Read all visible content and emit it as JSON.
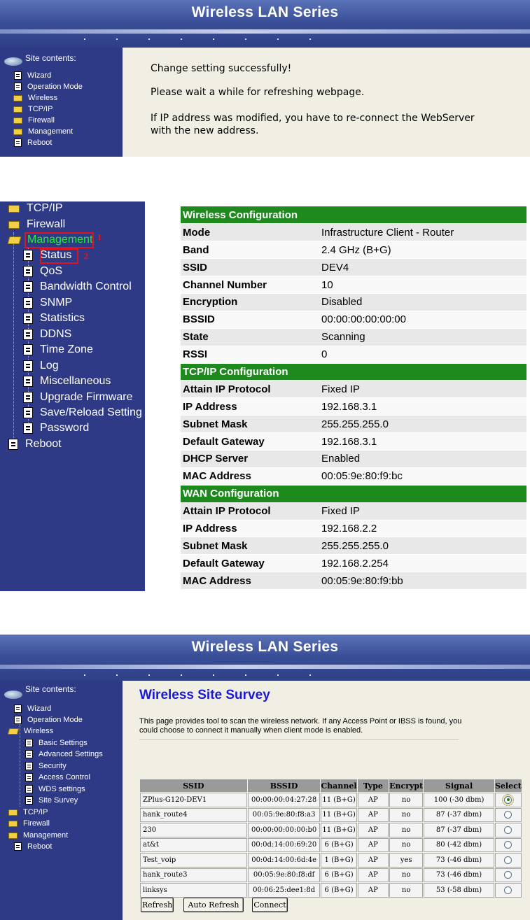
{
  "panel1": {
    "banner_title": "Wireless LAN Series",
    "sidebar_heading": "Site contents:",
    "nav": [
      {
        "label": "Wizard",
        "icon": "page-icon"
      },
      {
        "label": "Operation Mode",
        "icon": "page-icon"
      },
      {
        "label": "Wireless",
        "icon": "folder-icon"
      },
      {
        "label": "TCP/IP",
        "icon": "folder-icon"
      },
      {
        "label": "Firewall",
        "icon": "folder-icon"
      },
      {
        "label": "Management",
        "icon": "folder-icon"
      },
      {
        "label": "Reboot",
        "icon": "page-icon"
      }
    ],
    "messages": [
      "Change setting successfully!",
      "Please wait a while for refreshing webpage.",
      "If IP address was modified, you have to re-connect the WebServer",
      "with the new address."
    ]
  },
  "panel2": {
    "nav": {
      "tcpip": "TCP/IP",
      "firewall": "Firewall",
      "management": "Management",
      "items": [
        "Status",
        "QoS",
        "Bandwidth Control",
        "SNMP",
        "Statistics",
        "DDNS",
        "Time Zone",
        "Log",
        "Miscellaneous",
        "Upgrade Firmware",
        "Save/Reload Setting",
        "Password"
      ],
      "reboot": "Reboot"
    },
    "annotations": {
      "label1": "1",
      "label2": "2",
      "color": "#e0141e"
    },
    "sections": [
      {
        "title": "Wireless Configuration",
        "rows": [
          [
            "Mode",
            "Infrastructure Client - Router"
          ],
          [
            "Band",
            "2.4 GHz (B+G)"
          ],
          [
            "SSID",
            "DEV4"
          ],
          [
            "Channel Number",
            "10"
          ],
          [
            "Encryption",
            "Disabled"
          ],
          [
            "BSSID",
            "00:00:00:00:00:00"
          ],
          [
            "State",
            "Scanning"
          ],
          [
            "RSSI",
            "0"
          ]
        ]
      },
      {
        "title": "TCP/IP Configuration",
        "rows": [
          [
            "Attain IP Protocol",
            "Fixed IP"
          ],
          [
            "IP Address",
            "192.168.3.1"
          ],
          [
            "Subnet Mask",
            "255.255.255.0"
          ],
          [
            "Default Gateway",
            "192.168.3.1"
          ],
          [
            "DHCP Server",
            "Enabled"
          ],
          [
            "MAC Address",
            "00:05:9e:80:f9:bc"
          ]
        ]
      },
      {
        "title": "WAN Configuration",
        "rows": [
          [
            "Attain IP Protocol",
            "Fixed IP"
          ],
          [
            "IP Address",
            "192.168.2.2"
          ],
          [
            "Subnet Mask",
            "255.255.255.0"
          ],
          [
            "Default Gateway",
            "192.168.2.254"
          ],
          [
            "MAC Address",
            "00:05:9e:80:f9:bb"
          ]
        ]
      }
    ]
  },
  "panel3": {
    "banner_title": "Wireless LAN Series",
    "sidebar_heading": "Site contents:",
    "nav": {
      "wizard": "Wizard",
      "operation_mode": "Operation Mode",
      "wireless": "Wireless",
      "wireless_items": [
        "Basic Settings",
        "Advanced Settings",
        "Security",
        "Access Control",
        "WDS settings",
        "Site Survey"
      ],
      "tcpip": "TCP/IP",
      "firewall": "Firewall",
      "management": "Management",
      "reboot": "Reboot"
    },
    "title": "Wireless Site Survey",
    "description": "This page provides tool to scan the wireless network. If any Access Point or IBSS is found, you could choose to connect it manually when client mode is enabled.",
    "columns": [
      "SSID",
      "BSSID",
      "Channel",
      "Type",
      "Encrypt",
      "Signal",
      "Select"
    ],
    "rows": [
      {
        "ssid": "ZPlus-G120-DEV1",
        "bssid": "00:00:00:04:27:28",
        "channel": "11 (B+G)",
        "type": "AP",
        "encrypt": "no",
        "signal": "100 (-30 dbm)",
        "selected": true
      },
      {
        "ssid": "hank_route4",
        "bssid": "00:05:9e:80:f8:a3",
        "channel": "11 (B+G)",
        "type": "AP",
        "encrypt": "no",
        "signal": "87 (-37 dbm)",
        "selected": false
      },
      {
        "ssid": "230",
        "bssid": "00:00:00:00:00:b0",
        "channel": "11 (B+G)",
        "type": "AP",
        "encrypt": "no",
        "signal": "87 (-37 dbm)",
        "selected": false
      },
      {
        "ssid": "at&t",
        "bssid": "00:0d:14:00:69:20",
        "channel": "6 (B+G)",
        "type": "AP",
        "encrypt": "no",
        "signal": "80 (-42 dbm)",
        "selected": false
      },
      {
        "ssid": "Test_voip",
        "bssid": "00:0d:14:00:6d:4e",
        "channel": "1 (B+G)",
        "type": "AP",
        "encrypt": "yes",
        "signal": "73 (-46 dbm)",
        "selected": false
      },
      {
        "ssid": "hank_route3",
        "bssid": "00:05:9e:80:f8:df",
        "channel": "6 (B+G)",
        "type": "AP",
        "encrypt": "no",
        "signal": "73 (-46 dbm)",
        "selected": false
      },
      {
        "ssid": "linksys",
        "bssid": "00:06:25:dee1:8d",
        "channel": "6 (B+G)",
        "type": "AP",
        "encrypt": "no",
        "signal": "53 (-58 dbm)",
        "selected": false
      }
    ],
    "buttons": {
      "refresh": "Refresh",
      "auto_refresh": "Auto Refresh",
      "connect": "Connect"
    }
  }
}
